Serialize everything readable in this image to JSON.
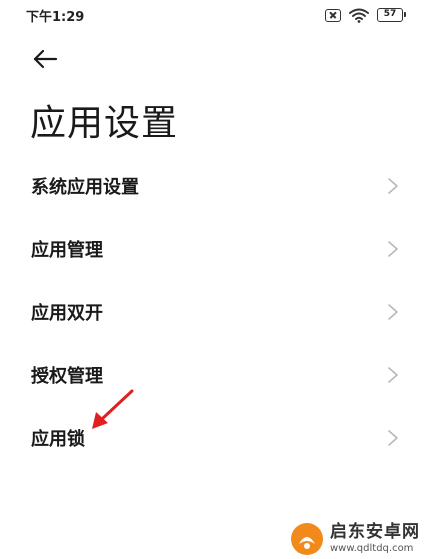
{
  "status_bar": {
    "time": "下午1:29",
    "battery": "57",
    "icons": [
      "sim-off-icon",
      "wifi-icon",
      "battery-icon"
    ]
  },
  "header": {
    "back_icon": "arrow-left-icon",
    "title": "应用设置"
  },
  "menu": {
    "items": [
      {
        "label": "系统应用设置"
      },
      {
        "label": "应用管理"
      },
      {
        "label": "应用双开"
      },
      {
        "label": "授权管理"
      },
      {
        "label": "应用锁"
      }
    ],
    "chevron_icon": "chevron-right-icon"
  },
  "annotation": {
    "icon": "red-arrow-icon",
    "color": "#e02020"
  },
  "watermark": {
    "name": "启东安卓网",
    "url": "www.qdltdq.com",
    "logo_icon": "qidong-logo-icon"
  },
  "colors": {
    "text": "#1a1a1a",
    "chevron": "#b8b8b8",
    "background": "#ffffff",
    "accent": "#f28a1b"
  }
}
